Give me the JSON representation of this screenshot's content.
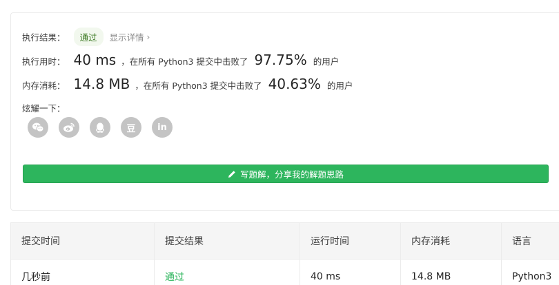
{
  "result": {
    "label": "执行结果：",
    "status": "通过",
    "details_link": "显示详情",
    "chevron": "›"
  },
  "runtime": {
    "label": "执行用时：",
    "value": "40 ms",
    "prefix": "，在所有 Python3 提交中击败了",
    "percent": "97.75%",
    "suffix": "的用户"
  },
  "memory": {
    "label": "内存消耗：",
    "value": "14.8 MB",
    "prefix": "，在所有 Python3 提交中击败了",
    "percent": "40.63%",
    "suffix": "的用户"
  },
  "share": {
    "label": "炫耀一下：",
    "icons": [
      "wechat-icon",
      "weibo-icon",
      "qq-icon",
      "douban-icon",
      "linkedin-icon"
    ],
    "douban_text": "豆",
    "linkedin_text": "in"
  },
  "write_button": {
    "label": "写题解，分享我的解题思路"
  },
  "table": {
    "headers": [
      "提交时间",
      "提交结果",
      "运行时间",
      "内存消耗",
      "语言"
    ],
    "rows": [
      [
        "几秒前",
        "通过",
        "40 ms",
        "14.8 MB",
        "Python3"
      ]
    ]
  },
  "colors": {
    "accent_green": "#2db55d",
    "icon_gray": "#c4c4c4",
    "badge_bg": "#f2f8ee"
  }
}
